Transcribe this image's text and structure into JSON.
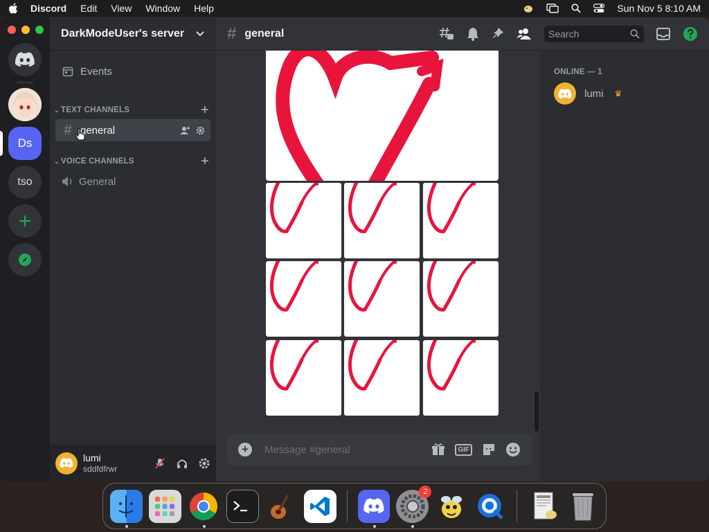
{
  "menubar": {
    "app_name": "Discord",
    "menus": [
      "Edit",
      "View",
      "Window",
      "Help"
    ],
    "clock": "Sun Nov 5  8:10 AM"
  },
  "guilds": {
    "home_icon": "discord-logo-icon",
    "items": [
      {
        "label": "Ds"
      },
      {
        "label": "tso"
      }
    ]
  },
  "sidebar": {
    "server_name": "DarkModeUser's server",
    "events_label": "Events",
    "text_category": "TEXT CHANNELS",
    "voice_category": "VOICE CHANNELS",
    "text_channels": [
      {
        "name": "general"
      }
    ],
    "voice_channels": [
      {
        "name": "General"
      }
    ]
  },
  "user": {
    "name": "lumi",
    "tag": "sddfdfrwr"
  },
  "chat": {
    "channel_name": "general",
    "search_placeholder": "Search",
    "composer_placeholder": "Message #general",
    "gif_label": "GIF"
  },
  "members": {
    "heading": "ONLINE — 1",
    "list": [
      {
        "name": "lumi",
        "badge": "crown-icon"
      }
    ]
  },
  "colors": {
    "blurple": "#5865f2",
    "green": "#23a55a",
    "heart_red": "#e8143c",
    "avatar_yellow": "#f0b232"
  },
  "dock": {
    "apps": [
      "Finder",
      "Launchpad",
      "Chrome",
      "Terminal",
      "GarageBand",
      "VS Code",
      "Discord",
      "System Settings",
      "Cyberduck",
      "QuickTime",
      "Preview",
      "Trash"
    ],
    "settings_badge": "2"
  }
}
